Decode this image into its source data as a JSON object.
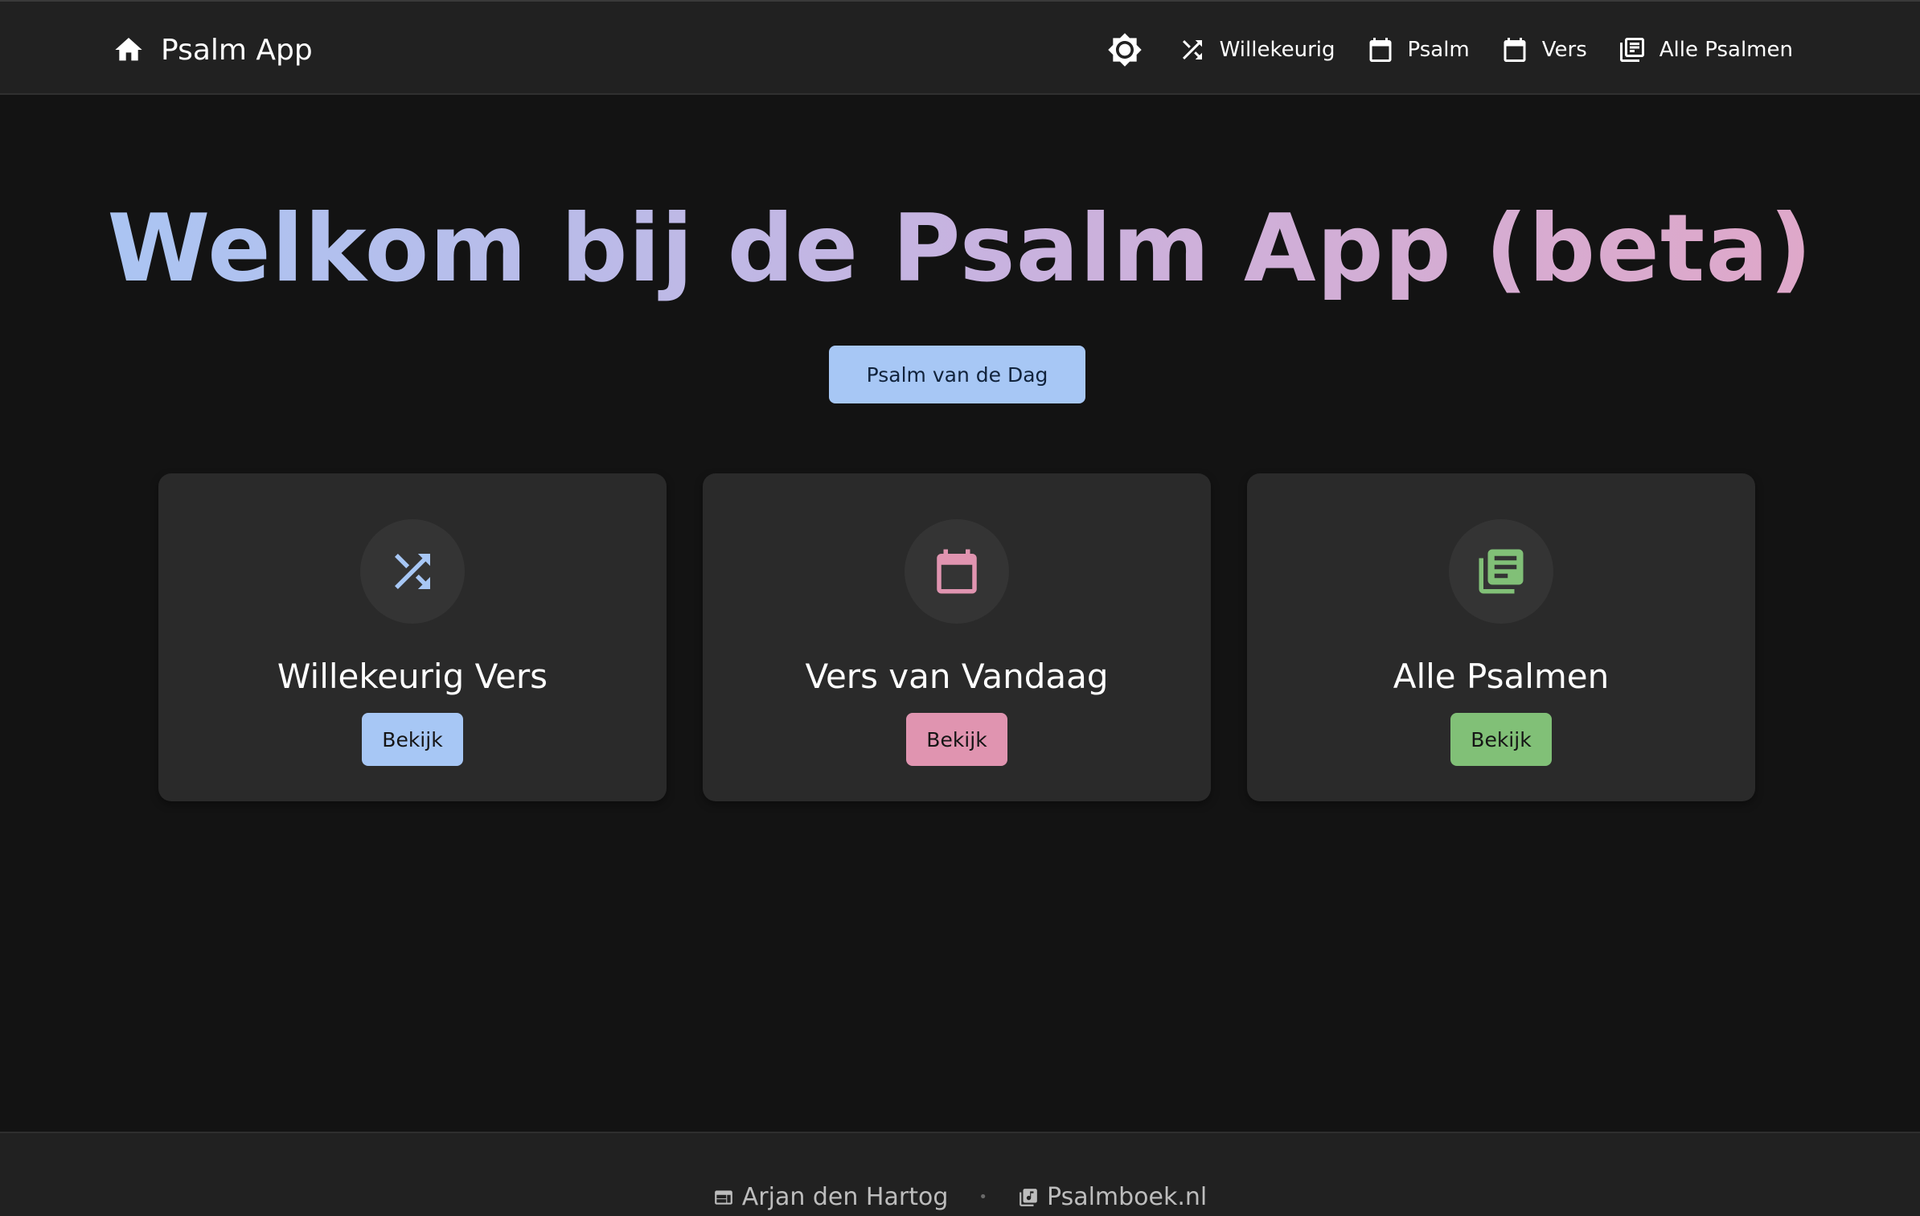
{
  "app": {
    "title": "Psalm App",
    "icon": "home-icon"
  },
  "nav": {
    "theme_icon": "brightness-icon",
    "items": [
      {
        "label": "Willekeurig",
        "icon": "shuffle-icon"
      },
      {
        "label": "Psalm",
        "icon": "calendar-icon"
      },
      {
        "label": "Vers",
        "icon": "calendar-icon"
      },
      {
        "label": "Alle Psalmen",
        "icon": "library-books-icon"
      }
    ]
  },
  "hero": {
    "title": "Welkom bij de Psalm App (beta)",
    "button": "Psalm van de Dag",
    "gradient": [
      "#a7c7f5",
      "#c7b3e0",
      "#e2a6c6"
    ]
  },
  "cards": [
    {
      "title": "Willekeurig Vers",
      "button": "Bekijk",
      "icon": "shuffle-icon",
      "accent": "#a7c7f5"
    },
    {
      "title": "Vers van Vandaag",
      "button": "Bekijk",
      "icon": "calendar-icon",
      "accent": "#e094b0"
    },
    {
      "title": "Alle Psalmen",
      "button": "Bekijk",
      "icon": "library-books-icon",
      "accent": "#81c077"
    }
  ],
  "footer": {
    "links": [
      {
        "label": "Arjan den Hartog",
        "icon": "web-icon"
      },
      {
        "label": "Psalmboek.nl",
        "icon": "library-music-icon"
      }
    ],
    "separator": "•"
  },
  "colors": {
    "background": "#131313",
    "bar": "#212121",
    "card": "#2a2a2a"
  }
}
